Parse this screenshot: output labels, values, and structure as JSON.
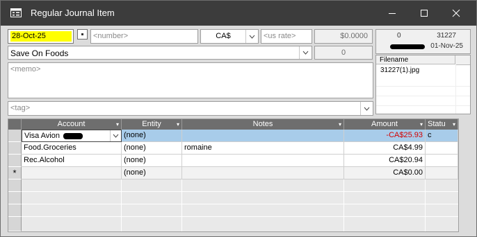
{
  "window": {
    "title": "Regular Journal Item"
  },
  "header": {
    "date": "28-Oct-25",
    "number_placeholder": "<number>",
    "currency": "CA$",
    "us_rate_placeholder": "<us rate>",
    "rate_value": "$0.0000",
    "payee": "Save On Foods",
    "payee_count": "0",
    "memo_placeholder": "<memo>",
    "tag_placeholder": "<tag>"
  },
  "info_panel": {
    "left_value": "0",
    "ref_number": "31227",
    "date": "01-Nov-25"
  },
  "attachments": {
    "column_header": "Filename",
    "files": [
      "31227(1).jpg"
    ]
  },
  "grid": {
    "columns": [
      "Account",
      "Entity",
      "Notes",
      "Amount",
      "Statu"
    ],
    "rows": [
      {
        "account": "Visa Avion",
        "entity": "(none)",
        "notes": "",
        "amount": "-CA$25.93",
        "status": "c"
      },
      {
        "account": "Food.Groceries",
        "entity": "(none)",
        "notes": "romaine",
        "amount": "CA$4.99",
        "status": ""
      },
      {
        "account": "Rec.Alcohol",
        "entity": "(none)",
        "notes": "",
        "amount": "CA$20.94",
        "status": ""
      },
      {
        "account": "",
        "entity": "(none)",
        "notes": "",
        "amount": "CA$0.00",
        "status": ""
      }
    ],
    "new_row_marker": "*"
  },
  "colors": {
    "highlight_yellow": "#ffff00",
    "selected_row": "#a8ccea",
    "negative_amount": "#d40000",
    "titlebar": "#3c3c3c"
  }
}
